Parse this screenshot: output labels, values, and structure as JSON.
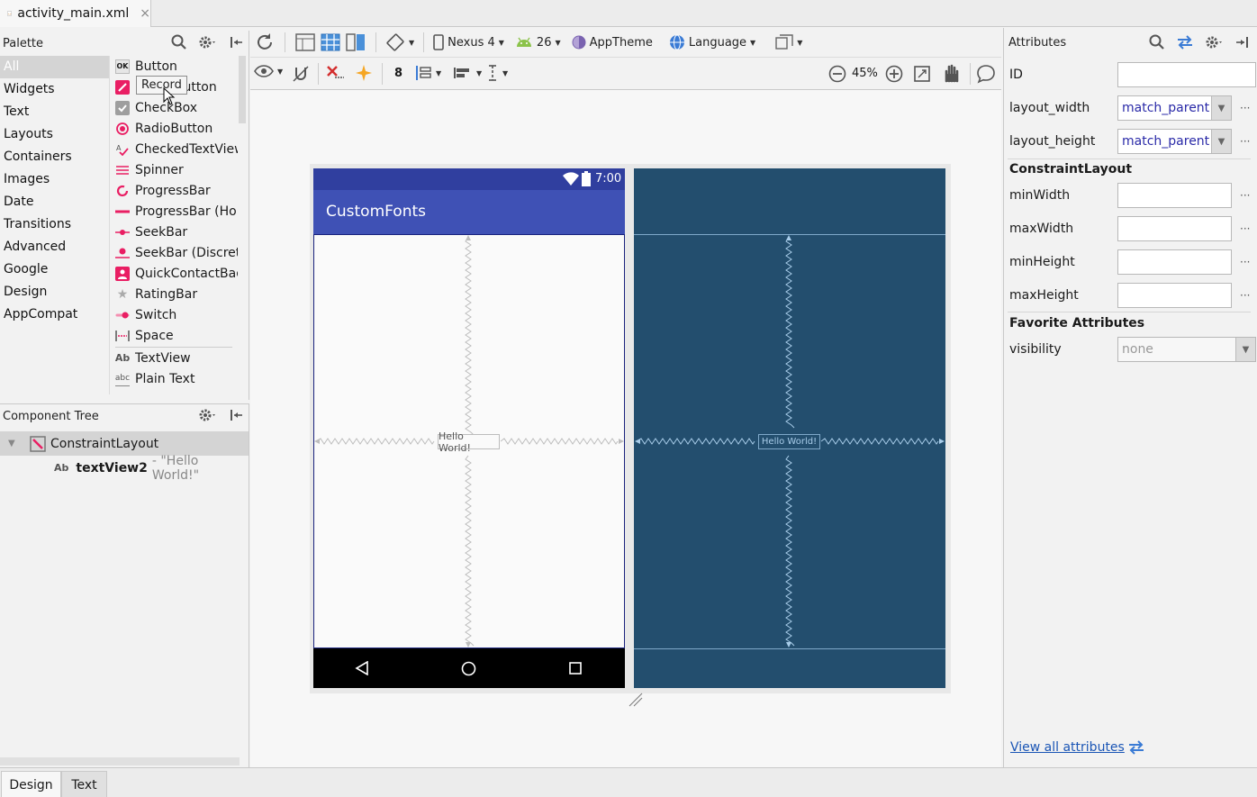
{
  "file_tab": {
    "label": "activity_main.xml",
    "close": "×"
  },
  "palette": {
    "title": "Palette",
    "categories": [
      "All",
      "Widgets",
      "Text",
      "Layouts",
      "Containers",
      "Images",
      "Date",
      "Transitions",
      "Advanced",
      "Google",
      "Design",
      "AppCompat"
    ],
    "items": [
      "Button",
      "ImageButton",
      "CheckBox",
      "RadioButton",
      "CheckedTextView",
      "Spinner",
      "ProgressBar",
      "ProgressBar (Horizontal)",
      "SeekBar",
      "SeekBar (Discrete)",
      "QuickContactBadge",
      "RatingBar",
      "Switch",
      "Space",
      "TextView",
      "Plain Text"
    ],
    "item_icon_text": {
      "button": "OK",
      "textview": "Ab",
      "plaintext": "abc"
    },
    "tooltip": "Record"
  },
  "component_tree": {
    "title": "Component Tree",
    "root": "ConstraintLayout",
    "child_icon": "Ab",
    "child_id": "textView2",
    "child_text": "- \"Hello World!\""
  },
  "toolbar": {
    "device": "Nexus 4",
    "api": "26",
    "theme": "AppTheme",
    "language": "Language",
    "margin": "8",
    "zoom": "45%"
  },
  "device": {
    "time": "7:00",
    "app_title": "CustomFonts",
    "hello": "Hello World!",
    "colors": {
      "status": "#303F9F",
      "appbar": "#3F51B5",
      "blueprint": "#234E6E",
      "navbar": "#000000"
    }
  },
  "attributes": {
    "title": "Attributes",
    "rows": [
      {
        "label": "ID",
        "value": ""
      },
      {
        "label": "layout_width",
        "value": "match_parent"
      },
      {
        "label": "layout_height",
        "value": "match_parent"
      }
    ],
    "constraint_title": "ConstraintLayout",
    "constraint_rows": [
      "minWidth",
      "maxWidth",
      "minHeight",
      "maxHeight"
    ],
    "favorite_title": "Favorite Attributes",
    "visibility_label": "visibility",
    "visibility_value": "none",
    "dots": "···",
    "view_all": "View all attributes"
  },
  "bottom_tabs": [
    "Design",
    "Text"
  ]
}
